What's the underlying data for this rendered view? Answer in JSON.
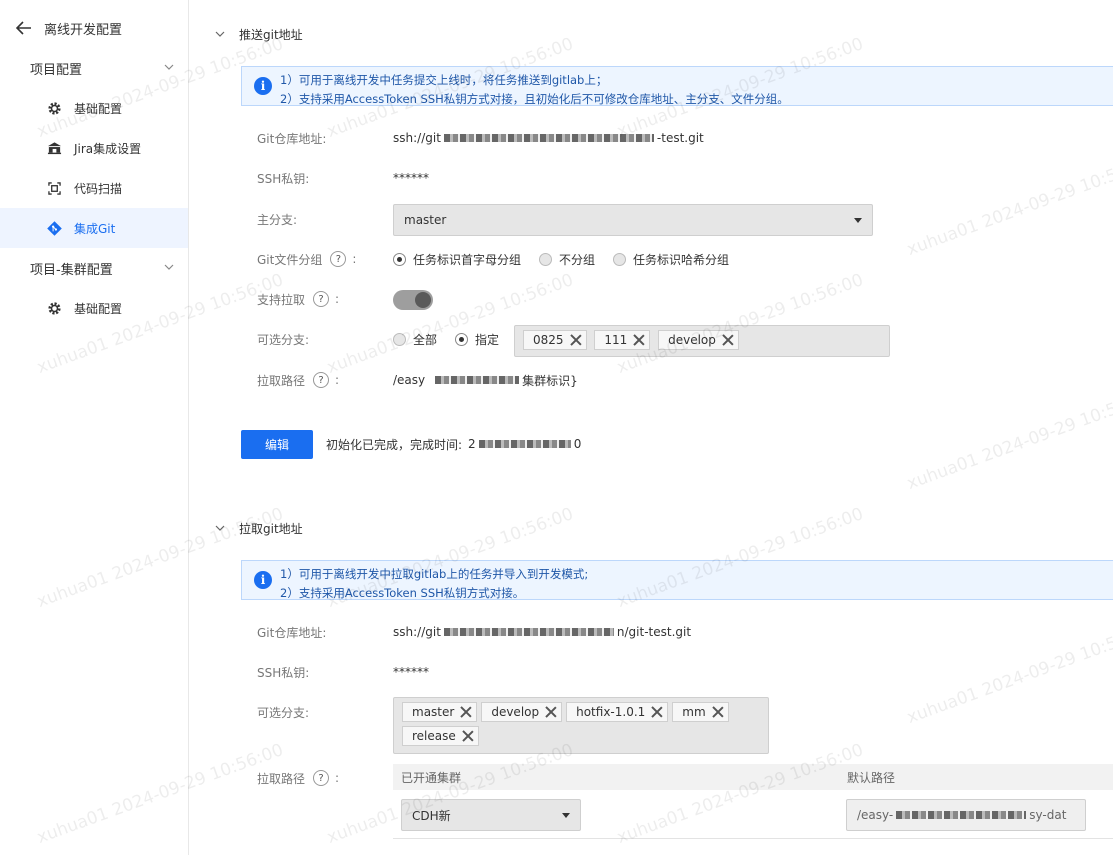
{
  "sidebar": {
    "title": "离线开发配置",
    "groups": [
      {
        "label": "项目配置",
        "items": [
          {
            "label": "基础配置",
            "icon": "gear-icon"
          },
          {
            "label": "Jira集成设置",
            "icon": "bank-icon"
          },
          {
            "label": "代码扫描",
            "icon": "scan-icon"
          },
          {
            "label": "集成Git",
            "icon": "git-icon",
            "active": true
          }
        ]
      },
      {
        "label": "项目-集群配置",
        "items": [
          {
            "label": "基础配置",
            "icon": "gear-icon"
          }
        ]
      }
    ]
  },
  "push": {
    "title": "推送git地址",
    "notice": [
      "1）可用于离线开发中任务提交上线时，将任务推送到gitlab上；",
      "2）支持采用AccessToken SSH私钥方式对接，且初始化后不可修改仓库地址、主分支、文件分组。"
    ],
    "repo_label": "Git仓库地址:",
    "repo_prefix": "ssh://git",
    "repo_suffix": "-test.git",
    "ssh_label": "SSH私钥:",
    "ssh_value": "******",
    "branch_label": "主分支:",
    "branch_value": "master",
    "group_label": "Git文件分组",
    "group_options": [
      "任务标识首字母分组",
      "不分组",
      "任务标识哈希分组"
    ],
    "pull_label": "支持拉取",
    "optional_label": "可选分支:",
    "optional_options": [
      "全部",
      "指定"
    ],
    "optional_tags": [
      "0825",
      "111",
      "develop"
    ],
    "path_label": "拉取路径",
    "path_prefix": "/easy",
    "path_suffix": "集群标识}",
    "edit_button": "编辑",
    "status_prefix": "初始化已完成，完成时间:",
    "status_start": "2",
    "status_end": "0"
  },
  "pull": {
    "title": "拉取git地址",
    "notice": [
      "1）可用于离线开发中拉取gitlab上的任务并导入到开发模式;",
      "2）支持采用AccessToken SSH私钥方式对接。"
    ],
    "repo_label": "Git仓库地址:",
    "repo_prefix": "ssh://git",
    "repo_suffix": "n/git-test.git",
    "ssh_label": "SSH私钥:",
    "ssh_value": "******",
    "optional_label": "可选分支:",
    "optional_tags": [
      "master",
      "develop",
      "hotfix-1.0.1",
      "mm",
      "release"
    ],
    "path_label": "拉取路径",
    "table_headers": [
      "已开通集群",
      "默认路径"
    ],
    "cluster_value": "CDH新",
    "default_path_prefix": "/easy-",
    "default_path_suffix": "sy-dat"
  },
  "watermark": "xuhua01 2024-09-29 10:56:00",
  "colors": {
    "accent": "#1a6ef0",
    "active_bg": "#eef4ff",
    "notice_bg": "#edf5ff"
  }
}
